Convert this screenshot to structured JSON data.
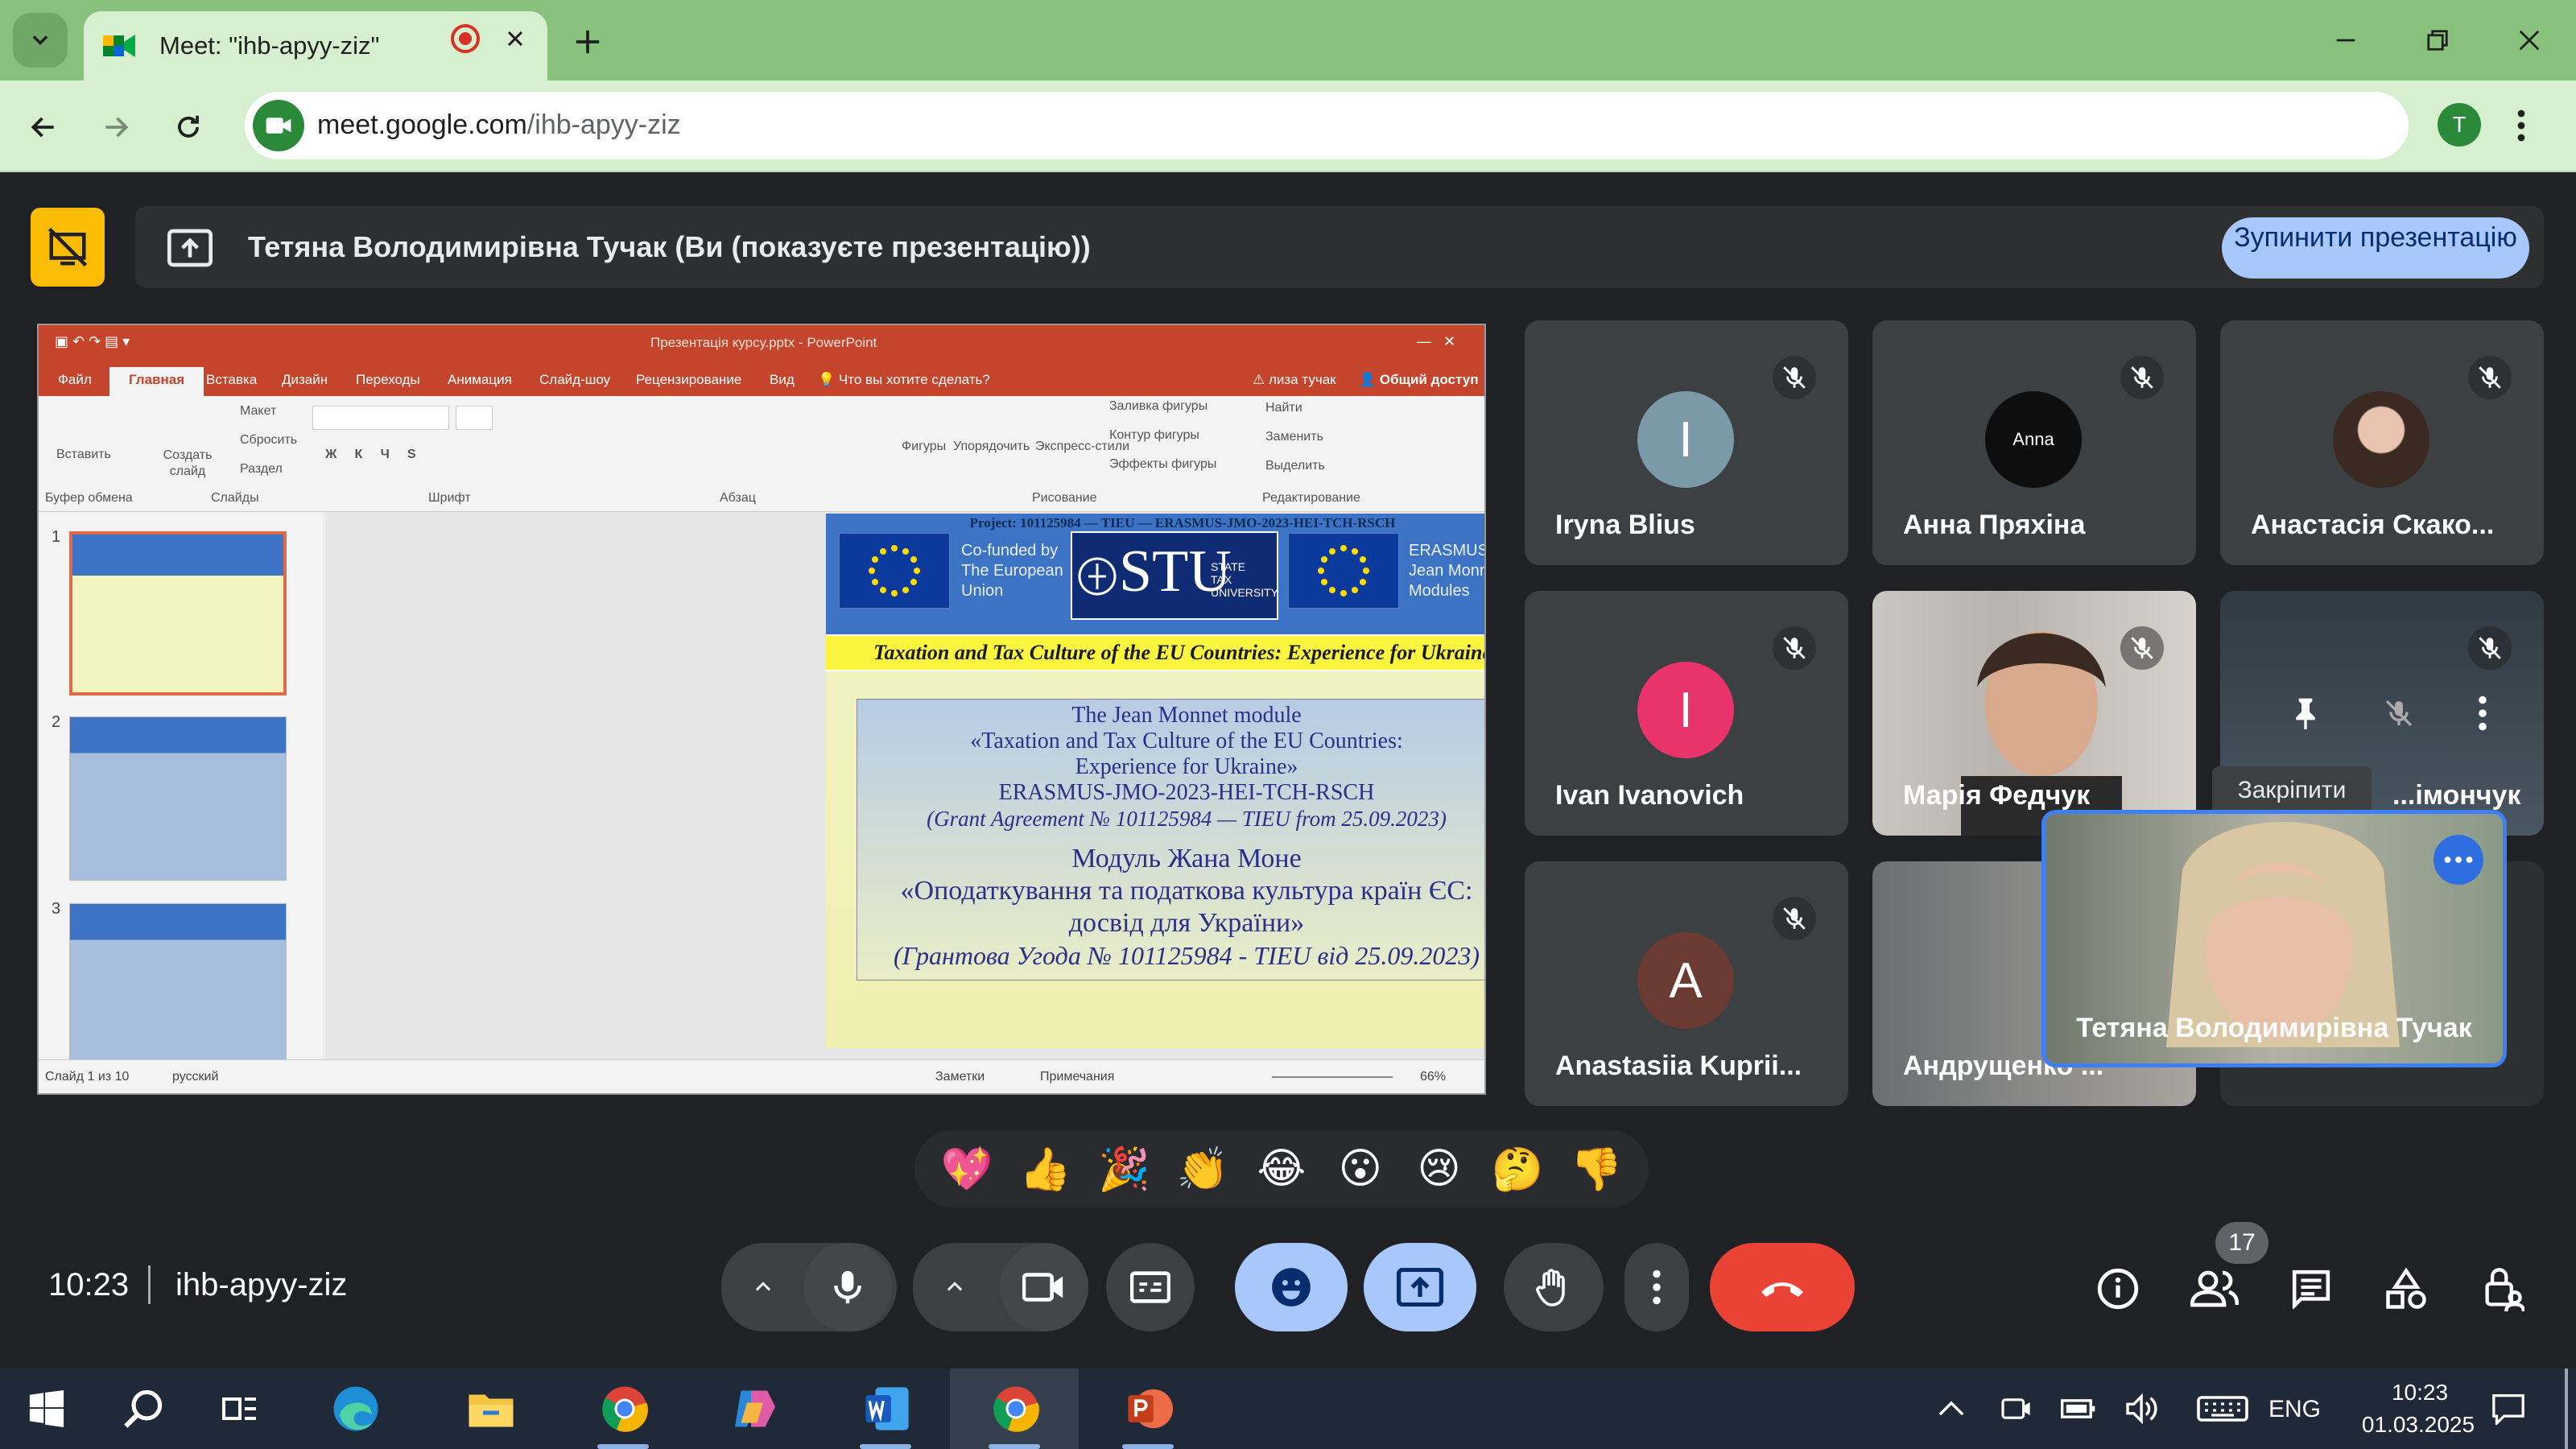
{
  "browser": {
    "tab_title": "Meet: \"ihb-apyy-ziz\"",
    "url_host": "meet.google.com",
    "url_path": "/ihb-apyy-ziz",
    "profile_initial": "T"
  },
  "presenting": {
    "text": "Тетяна Володимирівна Тучак (Ви (показуєте презентацію))",
    "stop_button": "Зупинити презентацію"
  },
  "ppt": {
    "window_title": "Презентація курсу.pptx - PowerPoint",
    "tabs": [
      "Файл",
      "Главная",
      "Вставка",
      "Дизайн",
      "Переходы",
      "Анимация",
      "Слайд-шоу",
      "Рецензирование",
      "Вид"
    ],
    "active_tab": "Главная",
    "tell_me": "Что вы хотите сделать?",
    "user": "лиза тучак",
    "share": "Общий доступ",
    "ribbon": {
      "paste": "Вставить",
      "new_slide": "Создать слайд",
      "layout": "Макет",
      "reset": "Сбросить",
      "section": "Раздел",
      "shapes": "Фигуры",
      "arrange": "Упорядочить",
      "quick_styles": "Экспресс-стили",
      "fill": "Заливка фигуры",
      "outline": "Контур фигуры",
      "effects": "Эффекты фигуры",
      "find": "Найти",
      "replace": "Заменить",
      "select": "Выделить"
    },
    "groups": [
      "Буфер обмена",
      "Слайды",
      "Шрифт",
      "Абзац",
      "Рисование",
      "Редактирование"
    ],
    "thumb_numbers": [
      "1",
      "2",
      "3"
    ],
    "status": {
      "slide": "Слайд 1 из 10",
      "lang": "русский",
      "notes": "Заметки",
      "comments": "Примечания",
      "zoom": "66%"
    },
    "slide": {
      "project": "Project: 101125984 — TIEU — ERASMUS-JMO-2023-HEI-TCH-RSCH",
      "cofunded": [
        "Co-funded by",
        "The European",
        "Union"
      ],
      "stu_big": "STU",
      "stu_small": [
        "STATE",
        "TAX",
        "UNIVERSITY"
      ],
      "erasmus": [
        "ERASMUS+",
        "Jean Monnet",
        "Modules"
      ],
      "band": "Taxation and Tax Culture of the EU Countries: Experience for Ukraine",
      "en_lines": [
        "The Jean Monnet module",
        "«Taxation and Tax Culture of the EU Countries:",
        "Experience for Ukraine»",
        "ERASMUS-JMO-2023-HEI-TCH-RSCH"
      ],
      "en_grant": "(Grant Agreement № 101125984 — TIEU from 25.09.2023)",
      "ua_lines": [
        "Модуль Жана Моне",
        "«Оподаткування та податкова культура країн ЄС:",
        "досвід для України»"
      ],
      "ua_grant": "(Грантова Угода №  101125984 - TIEU від 25.09.2023)"
    }
  },
  "participants": [
    {
      "name": "Iryna Blius",
      "initial": "I",
      "color": "#7b9aa8"
    },
    {
      "name": "Анна Пряхіна",
      "initial": "Anna",
      "color": "#0e0e0e"
    },
    {
      "name": "Анастасія Скако...",
      "initial": "",
      "color": "#555"
    },
    {
      "name": "Ivan Ivanovich",
      "initial": "I",
      "color": "#e8336b"
    },
    {
      "name": "Марія Федчук",
      "initial": "",
      "color": "#555"
    },
    {
      "name": "...імончук",
      "initial": "",
      "color": "#555"
    },
    {
      "name": "Anastasiia Kuprii...",
      "initial": "A",
      "color": "#6b3a32"
    },
    {
      "name": "Андрущенко ...",
      "initial": "",
      "color": "#555"
    }
  ],
  "self": {
    "name": "Тетяна Володимирівна Тучак"
  },
  "pin_tooltip": "Закріпити",
  "reactions": [
    "💖",
    "👍",
    "🎉",
    "👏",
    "😂",
    "😮",
    "😢",
    "🤔",
    "👎"
  ],
  "meeting": {
    "time": "10:23",
    "code": "ihb-apyy-ziz",
    "people_count": "17"
  },
  "taskbar": {
    "lang": "ENG",
    "time": "10:23",
    "date": "01.03.2025"
  },
  "colors": {
    "accent_blue": "#a8c7fa",
    "end_call": "#ea4335",
    "ppt_red": "#c5452c",
    "chrome_green": "#87c17c"
  }
}
